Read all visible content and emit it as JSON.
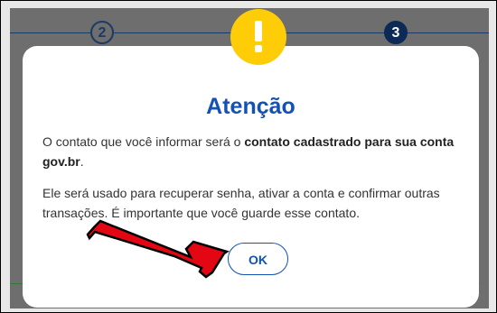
{
  "stepper": {
    "step_two": "2",
    "step_three": "3"
  },
  "modal": {
    "title": "Atenção",
    "paragraph1_plain": "O contato que você informar será o ",
    "paragraph1_bold": "contato cadastrado para sua conta gov.br",
    "paragraph1_end": ".",
    "paragraph2": "Ele será usado para recuperar senha, ativar a conta e confirmar outras transações. É importante que você guarde esse contato.",
    "ok_label": "OK",
    "alert_icon": "exclamation-icon"
  },
  "colors": {
    "accent": "#1351b4",
    "warning": "#ffcd07",
    "annotation_arrow": "#e30613"
  }
}
